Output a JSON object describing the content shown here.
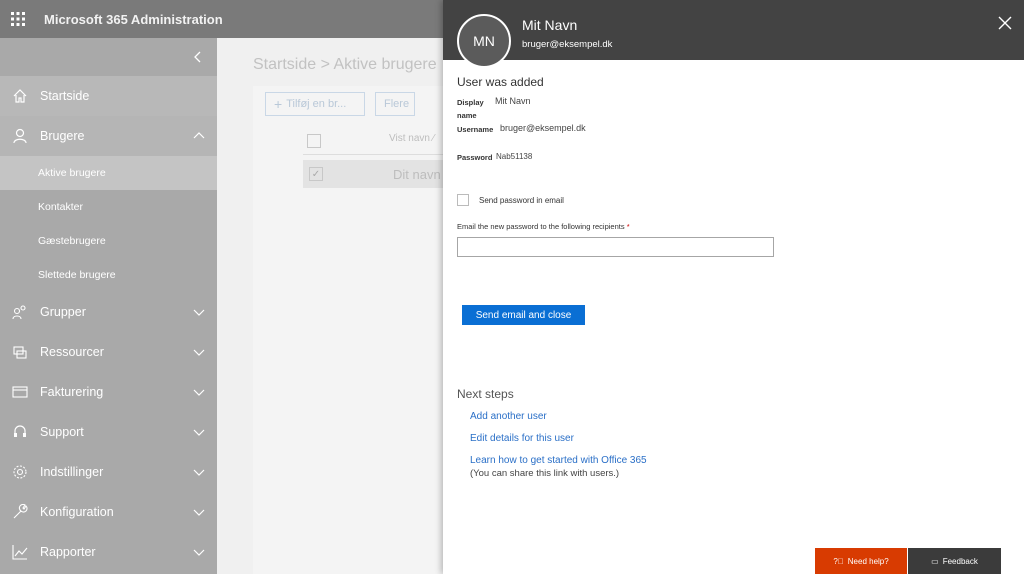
{
  "header": {
    "title": "Microsoft 365 Administration",
    "waffle_icon": "app-launcher-icon"
  },
  "sidebar": {
    "items": [
      {
        "label": "Startside",
        "icon": "home-icon"
      },
      {
        "label": "Brugere",
        "icon": "user-icon",
        "expanded": true,
        "children": [
          "Aktive brugere",
          "Kontakter",
          "Gæstebrugere",
          "Slettede brugere"
        ]
      },
      {
        "label": "Grupper",
        "icon": "groups-icon"
      },
      {
        "label": "Ressourcer",
        "icon": "resources-icon"
      },
      {
        "label": "Fakturering",
        "icon": "billing-icon"
      },
      {
        "label": "Support",
        "icon": "support-icon"
      },
      {
        "label": "Indstillinger",
        "icon": "settings-icon"
      },
      {
        "label": "Konfiguration",
        "icon": "setup-icon"
      },
      {
        "label": "Rapporter",
        "icon": "reports-icon"
      }
    ]
  },
  "main": {
    "breadcrumb": "Startside > Aktive brugere",
    "add_user_label": "Tilføj en br...",
    "more_label": "Flere",
    "column_header": "Vist navn",
    "row_name": "Dit navn"
  },
  "panel": {
    "avatar_initials": "MN",
    "user_name": "Mit Navn",
    "user_email": "bruger@eksempel.dk",
    "added_title": "User was added",
    "display_name_label": "Display name",
    "display_name_value": "Mit Navn",
    "username_label": "Username",
    "username_value": "bruger@eksempel.dk",
    "password_label": "Password",
    "password_value": "Nab51138",
    "send_password_label": "Send password in email",
    "send_password_checked": false,
    "email_recipients_label": "Email the new password to the following recipients",
    "email_recipients_value": "",
    "send_button": "Send email and close",
    "next_steps_title": "Next steps",
    "links": [
      "Add another user",
      "Edit details for this user",
      "Learn how to get started with Office 365"
    ],
    "share_note": "(You can share this link with users.)",
    "help_button": "Need help?",
    "feedback_button": "Feedback"
  },
  "colors": {
    "accent": "#0a6fd4",
    "help": "#d83b01",
    "panel_header": "#434343",
    "link": "#2a6fc7"
  }
}
